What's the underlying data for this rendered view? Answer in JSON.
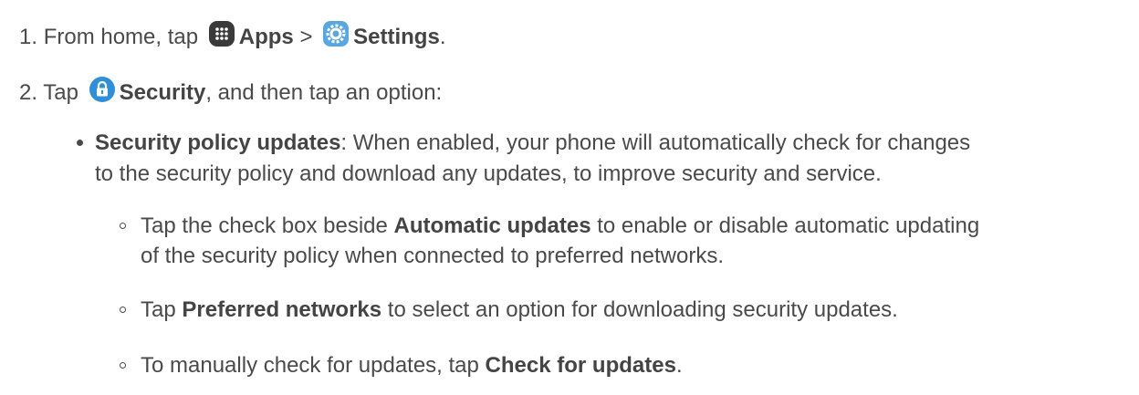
{
  "steps": [
    {
      "number": "1.",
      "prefix": "From home, tap",
      "apps_label": "Apps",
      "sep": ">",
      "settings_label": "Settings",
      "end": "."
    },
    {
      "number": "2.",
      "prefix": "Tap",
      "security_label": "Security",
      "suffix": ", and then tap an option:"
    }
  ],
  "option": {
    "title": "Security policy updates",
    "text_line1": ": When enabled, your phone will automatically check for changes",
    "text_line2": "to the security policy and download any updates, to improve security and service."
  },
  "subitems": [
    {
      "pre": "Tap the check box beside ",
      "bold": "Automatic updates",
      "post": " to enable or disable automatic updating",
      "line2": "of the security policy when connected to preferred networks."
    },
    {
      "pre": "Tap ",
      "bold": "Preferred networks",
      "post": " to select an option for downloading security updates."
    },
    {
      "pre": "To manually check for updates, tap ",
      "bold": "Check for updates",
      "post": "."
    }
  ],
  "icons": {
    "apps": "apps-grid-icon",
    "settings": "settings-gear-icon",
    "security": "lock-icon"
  },
  "colors": {
    "text": "#4a4a4a",
    "apps_icon_bg": "#3a3a3a",
    "settings_icon_bg": "#5aa6e0",
    "security_icon_bg": "#2f8fd8"
  }
}
